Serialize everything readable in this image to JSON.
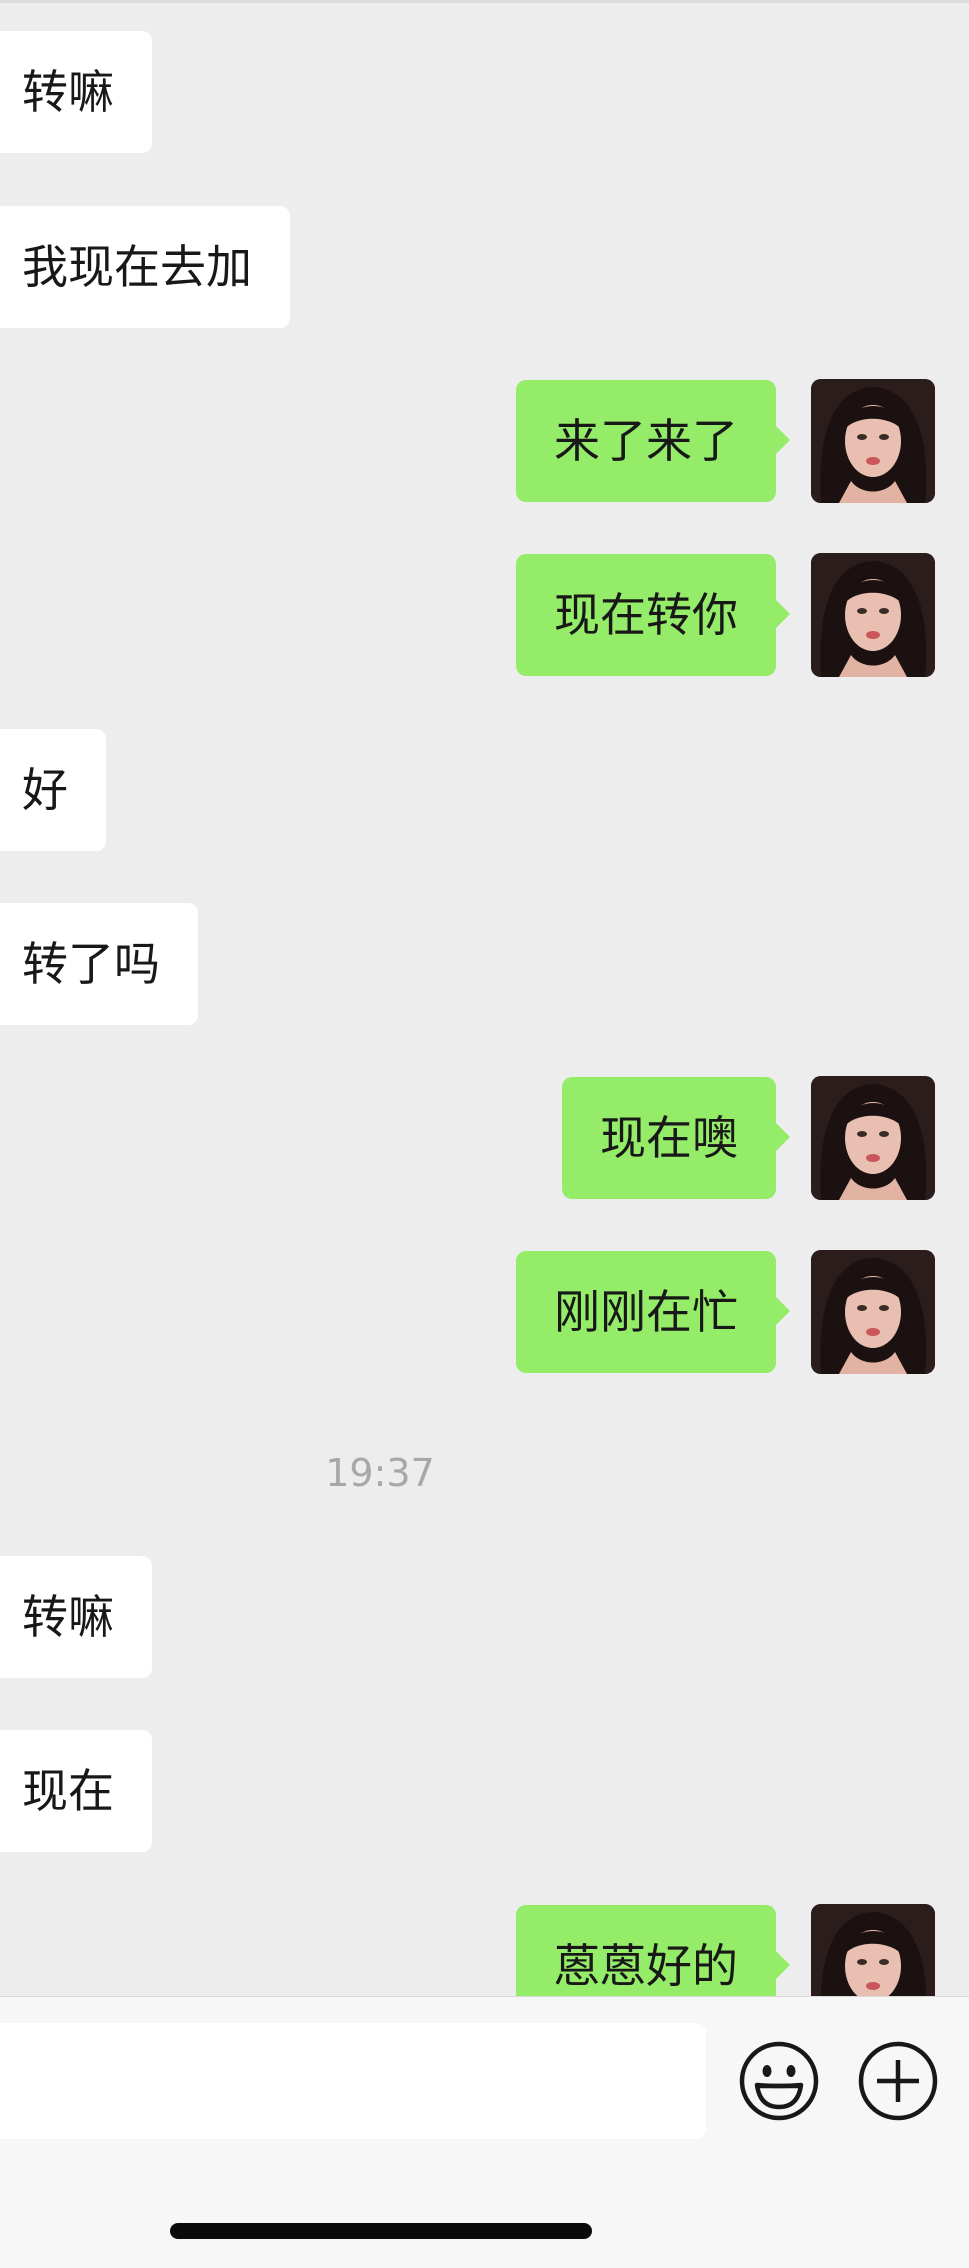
{
  "messages": [
    {
      "side": "in",
      "text": "转嘛"
    },
    {
      "side": "in",
      "text": "我现在去加"
    },
    {
      "side": "out",
      "text": "来了来了"
    },
    {
      "side": "out",
      "text": "现在转你"
    },
    {
      "side": "in",
      "text": "好"
    },
    {
      "side": "in",
      "text": "转了吗"
    },
    {
      "side": "out",
      "text": "现在噢"
    },
    {
      "side": "out",
      "text": "刚刚在忙"
    },
    {
      "side": "time",
      "text": "19:37"
    },
    {
      "side": "in",
      "text": "转嘛"
    },
    {
      "side": "in",
      "text": "现在"
    },
    {
      "side": "out",
      "text": "蒽蒽好的"
    }
  ],
  "input": {
    "value": "",
    "emoji_icon": "smiley-icon",
    "more_icon": "plus-circle-icon"
  },
  "colors": {
    "background": "#ededed",
    "incoming_bubble": "#ffffff",
    "outgoing_bubble": "#95ec69",
    "timestamp": "#a8a8a8"
  }
}
